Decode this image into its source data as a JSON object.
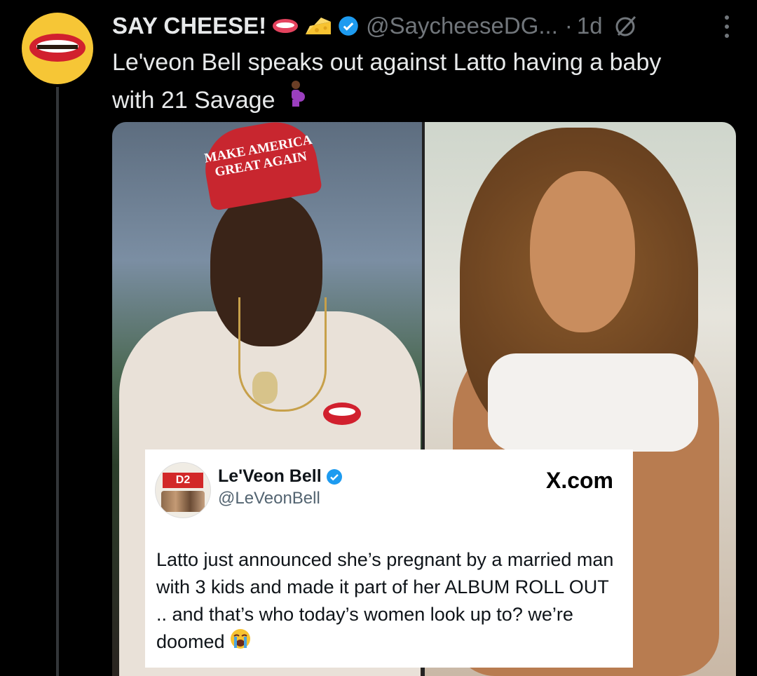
{
  "tweet": {
    "display_name": "SAY CHEESE!",
    "handle": "@SaycheeseDG...",
    "separator": "·",
    "time": "1d",
    "text_line1": "Le'veon Bell speaks out against Latto having a baby",
    "text_line2": "with 21 Savage",
    "emoji_after_name": [
      "lips-icon",
      "cheese-icon"
    ],
    "accent_color": "#1d9bf0"
  },
  "media": {
    "hat_line1": "MAKE AMERICA",
    "hat_line2": "GREAT AGAIN"
  },
  "embed": {
    "name": "Le'Veon Bell",
    "handle": "@LeVeonBell",
    "brand": "X.com",
    "avatar_text": "D2",
    "text": "Latto just announced she’s pregnant by a married man with 3 kids and made it part of her ALBUM ROLL OUT .. and that’s who today’s women look up to? we’re doomed"
  }
}
